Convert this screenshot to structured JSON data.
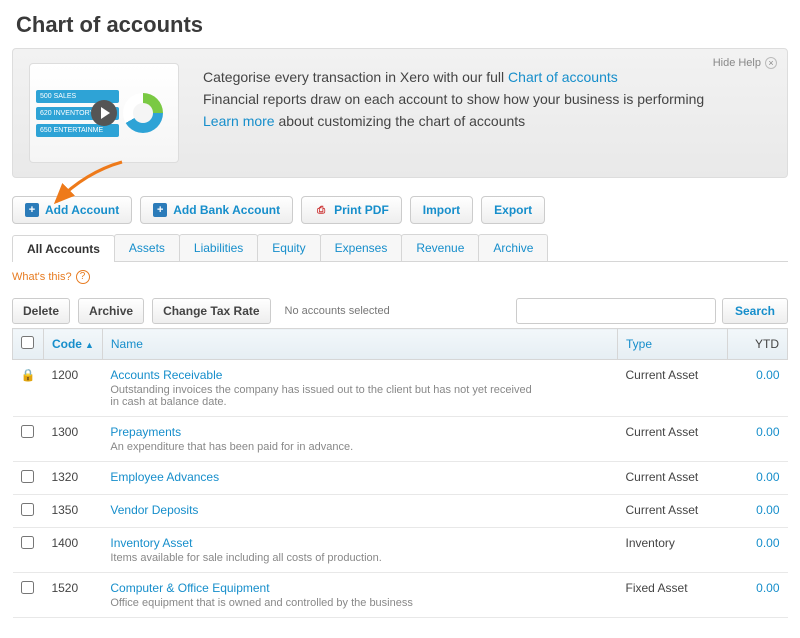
{
  "page_title": "Chart of accounts",
  "help": {
    "hide_label": "Hide Help",
    "illus_items": [
      "500 SALES",
      "620 INVENTORY",
      "650 ENTERTAINME"
    ],
    "line1_pre": "Categorise every transaction in Xero with our full ",
    "line1_link": "Chart of accounts",
    "line2": "Financial reports draw on each account to show how your business is performing",
    "line3_link": "Learn more",
    "line3_post": " about customizing the chart of accounts"
  },
  "toolbar": {
    "add_account": "Add Account",
    "add_bank_account": "Add Bank Account",
    "print_pdf": "Print PDF",
    "import": "Import",
    "export": "Export"
  },
  "tabs": [
    "All Accounts",
    "Assets",
    "Liabilities",
    "Equity",
    "Expenses",
    "Revenue",
    "Archive"
  ],
  "active_tab": 0,
  "whats_this": "What's this?",
  "table_actions": {
    "delete": "Delete",
    "archive": "Archive",
    "change_tax_rate": "Change Tax Rate",
    "no_selection": "No accounts selected",
    "search": "Search",
    "search_placeholder": ""
  },
  "columns": {
    "code": "Code",
    "name": "Name",
    "type": "Type",
    "ytd": "YTD"
  },
  "rows": [
    {
      "locked": true,
      "code": "1200",
      "name": "Accounts Receivable",
      "desc": "Outstanding invoices the company has issued out to the client but has not yet received in cash at balance date.",
      "type": "Current Asset",
      "ytd": "0.00"
    },
    {
      "locked": false,
      "code": "1300",
      "name": "Prepayments",
      "desc": "An expenditure that has been paid for in advance.",
      "type": "Current Asset",
      "ytd": "0.00"
    },
    {
      "locked": false,
      "code": "1320",
      "name": "Employee Advances",
      "desc": "",
      "type": "Current Asset",
      "ytd": "0.00"
    },
    {
      "locked": false,
      "code": "1350",
      "name": "Vendor Deposits",
      "desc": "",
      "type": "Current Asset",
      "ytd": "0.00"
    },
    {
      "locked": false,
      "code": "1400",
      "name": "Inventory Asset",
      "desc": "Items available for sale including all costs of production.",
      "type": "Inventory",
      "ytd": "0.00"
    },
    {
      "locked": false,
      "code": "1520",
      "name": "Computer & Office Equipment",
      "desc": "Office equipment that is owned and controlled by the business",
      "type": "Fixed Asset",
      "ytd": "0.00"
    }
  ]
}
